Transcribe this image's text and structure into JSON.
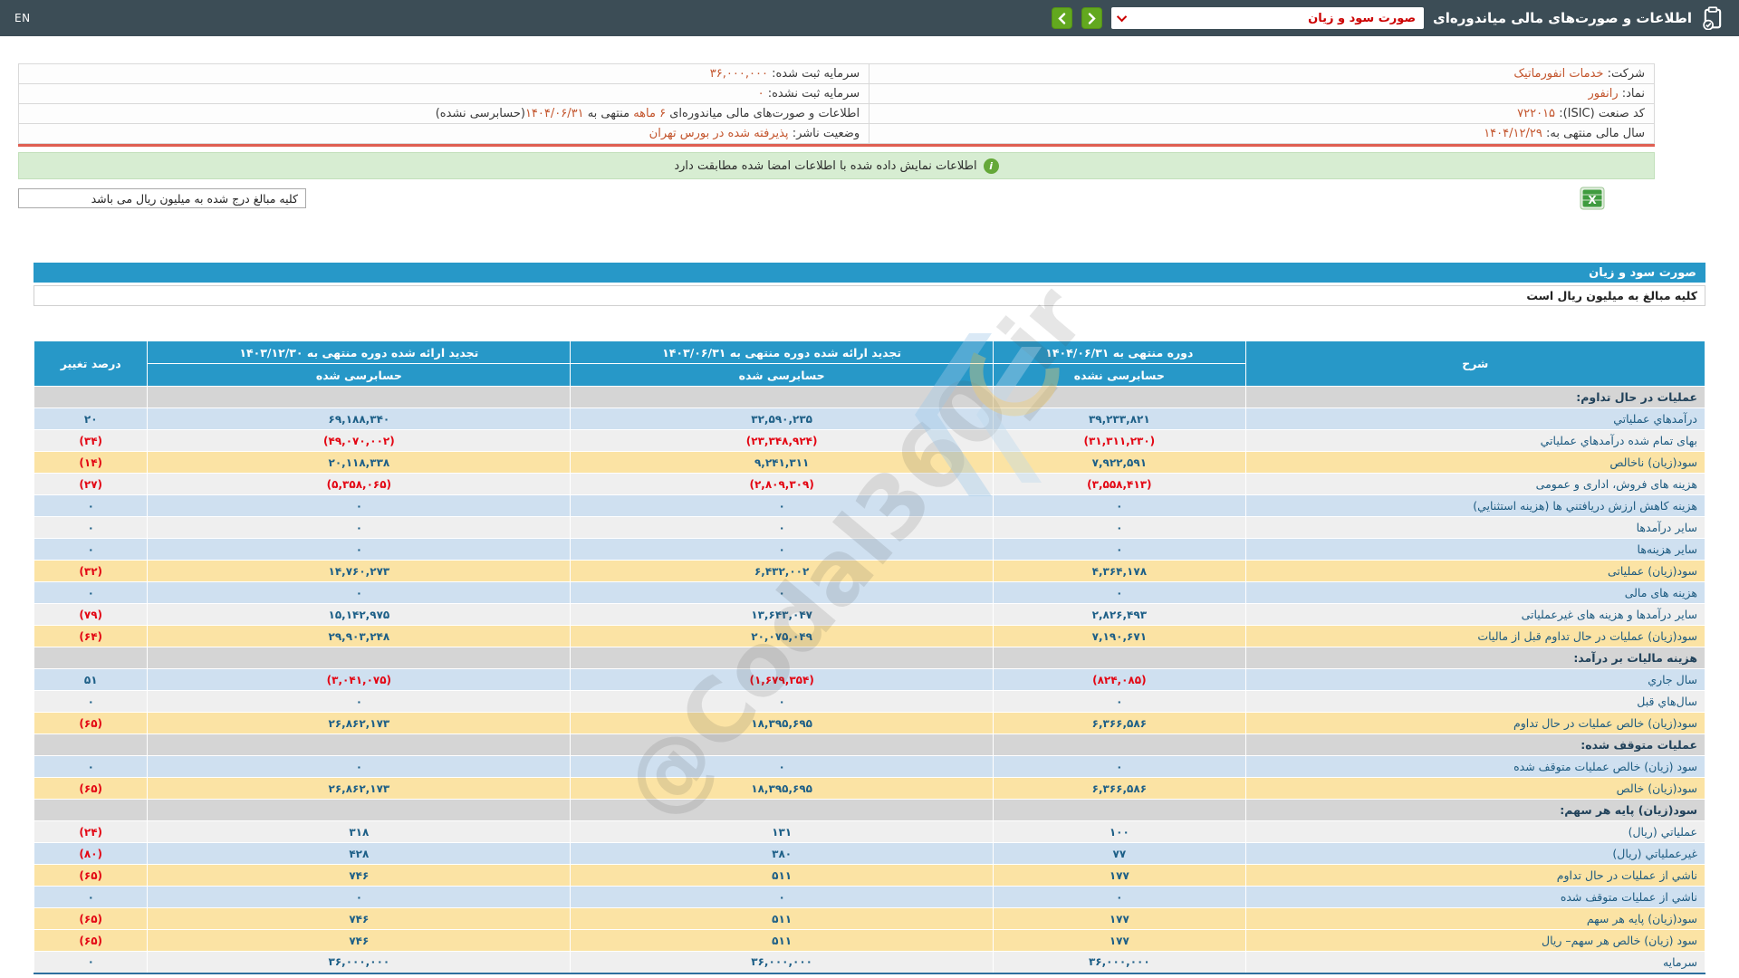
{
  "topbar": {
    "lang_label": "EN",
    "title": "اطلاعات و صورت‌های مالی میاندوره‌ای",
    "select_value": "صورت سود و زیان"
  },
  "info": {
    "rows": [
      {
        "right_label": "شرکت:",
        "right_value": "خدمات انفورماتیک",
        "left_label": "سرمایه ثبت شده:",
        "left_value": "۳۶,۰۰۰,۰۰۰"
      },
      {
        "right_label": "نماد:",
        "right_value": "رانفور",
        "left_label": "سرمایه ثبت نشده:",
        "left_value": "۰"
      },
      {
        "right_label": "کد صنعت (ISIC):",
        "right_value": "۷۲۲۰۱۵",
        "left_label": "اطلاعات و صورت‌های مالی میاندوره‌ای ",
        "left_hl1": "۶ ماهه",
        "left_mid": " منتهی به ",
        "left_hl2": "۱۴۰۴/۰۶/۳۱",
        "left_tail": "(حسابرسی نشده)"
      },
      {
        "right_label": "سال مالی منتهی به:",
        "right_value": "۱۴۰۴/۱۲/۲۹",
        "left_label": "وضعیت ناشر:",
        "left_value": "پذیرفته شده در بورس تهران"
      }
    ],
    "banner_text": "اطلاعات نمایش داده شده با اطلاعات امضا شده مطابقت دارد",
    "banner_icon": "i",
    "units_note": "کلیه مبالغ درج شده به میلیون ریال می باشد"
  },
  "statement": {
    "title": "صورت سود و زیان",
    "units_note": "کلیه مبالغ به میلیون ریال است",
    "header": {
      "col_desc": "شرح",
      "col1_line1": "دوره منتهی به ۱۴۰۴/۰۶/۳۱",
      "col1_line2": "حسابرسی نشده",
      "col2_line1": "تجدید ارائه شده دوره منتهی به ۱۴۰۳/۰۶/۳۱",
      "col2_line2": "حسابرسی شده",
      "col3_line1": "تجدید ارائه شده دوره منتهی به ۱۴۰۳/۱۲/۳۰",
      "col3_line2": "حسابرسی شده",
      "col_pct": "درصد تغییر"
    },
    "rows": [
      {
        "type": "section",
        "label": "عملیات در حال تداوم:"
      },
      {
        "type": "data",
        "bg": "blue",
        "label": "درآمدهاي عملياتي",
        "v1": "۳۹,۲۳۳,۸۲۱",
        "v2": "۳۲,۵۹۰,۲۳۵",
        "v3": "۶۹,۱۸۸,۳۴۰",
        "pct": "۲۰"
      },
      {
        "type": "data",
        "bg": "light",
        "label": "بهای تمام شده درآمدهاي عملياتي",
        "v1": "(۳۱,۳۱۱,۲۳۰)",
        "v2": "(۲۳,۳۴۸,۹۲۴)",
        "v3": "(۴۹,۰۷۰,۰۰۲)",
        "pct": "(۳۴)"
      },
      {
        "type": "data",
        "bg": "yellow",
        "label": "سود(زیان) ناخالص",
        "v1": "۷,۹۲۲,۵۹۱",
        "v2": "۹,۲۴۱,۳۱۱",
        "v3": "۲۰,۱۱۸,۳۳۸",
        "pct": "(۱۴)"
      },
      {
        "type": "data",
        "bg": "light",
        "label": "هزینه های فروش، اداری و عمومی",
        "v1": "(۳,۵۵۸,۴۱۳)",
        "v2": "(۲,۸۰۹,۳۰۹)",
        "v3": "(۵,۳۵۸,۰۶۵)",
        "pct": "(۲۷)"
      },
      {
        "type": "data",
        "bg": "blue",
        "label": "هزینه کاهش ارزش دریافتني ها (هزینه استثنایي)",
        "v1": "۰",
        "v2": "۰",
        "v3": "۰",
        "pct": "۰"
      },
      {
        "type": "data",
        "bg": "light",
        "label": "سایر درآمدها",
        "v1": "۰",
        "v2": "۰",
        "v3": "۰",
        "pct": "۰"
      },
      {
        "type": "data",
        "bg": "blue",
        "label": "سایر هزینه‌ها",
        "v1": "۰",
        "v2": "۰",
        "v3": "۰",
        "pct": "۰"
      },
      {
        "type": "data",
        "bg": "yellow",
        "label": "سود(زیان) عملیاتی",
        "v1": "۴,۳۶۴,۱۷۸",
        "v2": "۶,۴۳۲,۰۰۲",
        "v3": "۱۴,۷۶۰,۲۷۳",
        "pct": "(۳۲)"
      },
      {
        "type": "data",
        "bg": "blue",
        "label": "هزینه های مالی",
        "v1": "۰",
        "v2": "۰",
        "v3": "۰",
        "pct": "۰"
      },
      {
        "type": "data",
        "bg": "light",
        "label": "سایر درآمدها و هزینه های غیرعملیاتی",
        "v1": "۲,۸۲۶,۴۹۳",
        "v2": "۱۳,۶۴۳,۰۴۷",
        "v3": "۱۵,۱۴۲,۹۷۵",
        "pct": "(۷۹)"
      },
      {
        "type": "data",
        "bg": "yellow",
        "label": "سود(زیان) عملیات در حال تداوم قبل از مالیات",
        "v1": "۷,۱۹۰,۶۷۱",
        "v2": "۲۰,۰۷۵,۰۴۹",
        "v3": "۲۹,۹۰۳,۲۴۸",
        "pct": "(۶۴)"
      },
      {
        "type": "section",
        "label": "هزینه مالیات بر درآمد:"
      },
      {
        "type": "data",
        "bg": "blue",
        "label": "سال جاري",
        "v1": "(۸۲۴,۰۸۵)",
        "v2": "(۱,۶۷۹,۳۵۴)",
        "v3": "(۳,۰۴۱,۰۷۵)",
        "pct": "۵۱"
      },
      {
        "type": "data",
        "bg": "light",
        "label": "سال‌هاي قبل",
        "v1": "۰",
        "v2": "۰",
        "v3": "۰",
        "pct": "۰"
      },
      {
        "type": "data",
        "bg": "yellow",
        "label": "سود(زیان) خالص عملیات در حال تداوم",
        "v1": "۶,۳۶۶,۵۸۶",
        "v2": "۱۸,۳۹۵,۶۹۵",
        "v3": "۲۶,۸۶۲,۱۷۳",
        "pct": "(۶۵)"
      },
      {
        "type": "section",
        "label": "عملیات متوقف شده:"
      },
      {
        "type": "data",
        "bg": "blue",
        "label": "سود (زیان) خالص عملیات متوقف شده",
        "v1": "۰",
        "v2": "۰",
        "v3": "۰",
        "pct": "۰"
      },
      {
        "type": "data",
        "bg": "yellow",
        "label": "سود(زیان) خالص",
        "v1": "۶,۳۶۶,۵۸۶",
        "v2": "۱۸,۳۹۵,۶۹۵",
        "v3": "۲۶,۸۶۲,۱۷۳",
        "pct": "(۶۵)"
      },
      {
        "type": "section",
        "label": "سود(زیان) پایه هر سهم:"
      },
      {
        "type": "data",
        "bg": "light",
        "label": "عملیاتي (ریال)",
        "v1": "۱۰۰",
        "v2": "۱۳۱",
        "v3": "۳۱۸",
        "pct": "(۲۴)"
      },
      {
        "type": "data",
        "bg": "blue",
        "label": "غیرعملیاتي (ریال)",
        "v1": "۷۷",
        "v2": "۳۸۰",
        "v3": "۴۲۸",
        "pct": "(۸۰)"
      },
      {
        "type": "data",
        "bg": "yellow",
        "label": "ناشي از عملیات در حال تداوم",
        "v1": "۱۷۷",
        "v2": "۵۱۱",
        "v3": "۷۴۶",
        "pct": "(۶۵)"
      },
      {
        "type": "data",
        "bg": "blue",
        "label": "ناشي از عملیات متوقف شده",
        "v1": "۰",
        "v2": "۰",
        "v3": "۰",
        "pct": "۰"
      },
      {
        "type": "data",
        "bg": "yellow",
        "label": "سود(زیان) پایه هر سهم",
        "v1": "۱۷۷",
        "v2": "۵۱۱",
        "v3": "۷۴۶",
        "pct": "(۶۵)"
      },
      {
        "type": "data",
        "bg": "yellow",
        "label": "سود (زیان) خالص هر سهم– ریال",
        "v1": "۱۷۷",
        "v2": "۵۱۱",
        "v3": "۷۴۶",
        "pct": "(۶۵)"
      },
      {
        "type": "data",
        "bg": "light",
        "label": "سرمایه",
        "v1": "۳۶,۰۰۰,۰۰۰",
        "v2": "۳۶,۰۰۰,۰۰۰",
        "v3": "۳۶,۰۰۰,۰۰۰",
        "pct": "۰"
      }
    ]
  },
  "watermark": {
    "text": "@Codal360_ir"
  },
  "colors": {
    "topbar_bg": "#3c4d56",
    "accent_teal": "#2798c8",
    "nav_green": "#62a81f",
    "dropdown_red": "#cc0000",
    "value_orange": "#c3552d",
    "separator_red": "#df5f52",
    "banner_green_bg": "#d7edd2",
    "row_blue": "#cfe0f0",
    "row_yellow": "#fbe3a4",
    "row_gray": "#efefef",
    "section_gray": "#d5d5d5",
    "number_positive": "#1d5f87",
    "number_negative": "#e30613"
  }
}
